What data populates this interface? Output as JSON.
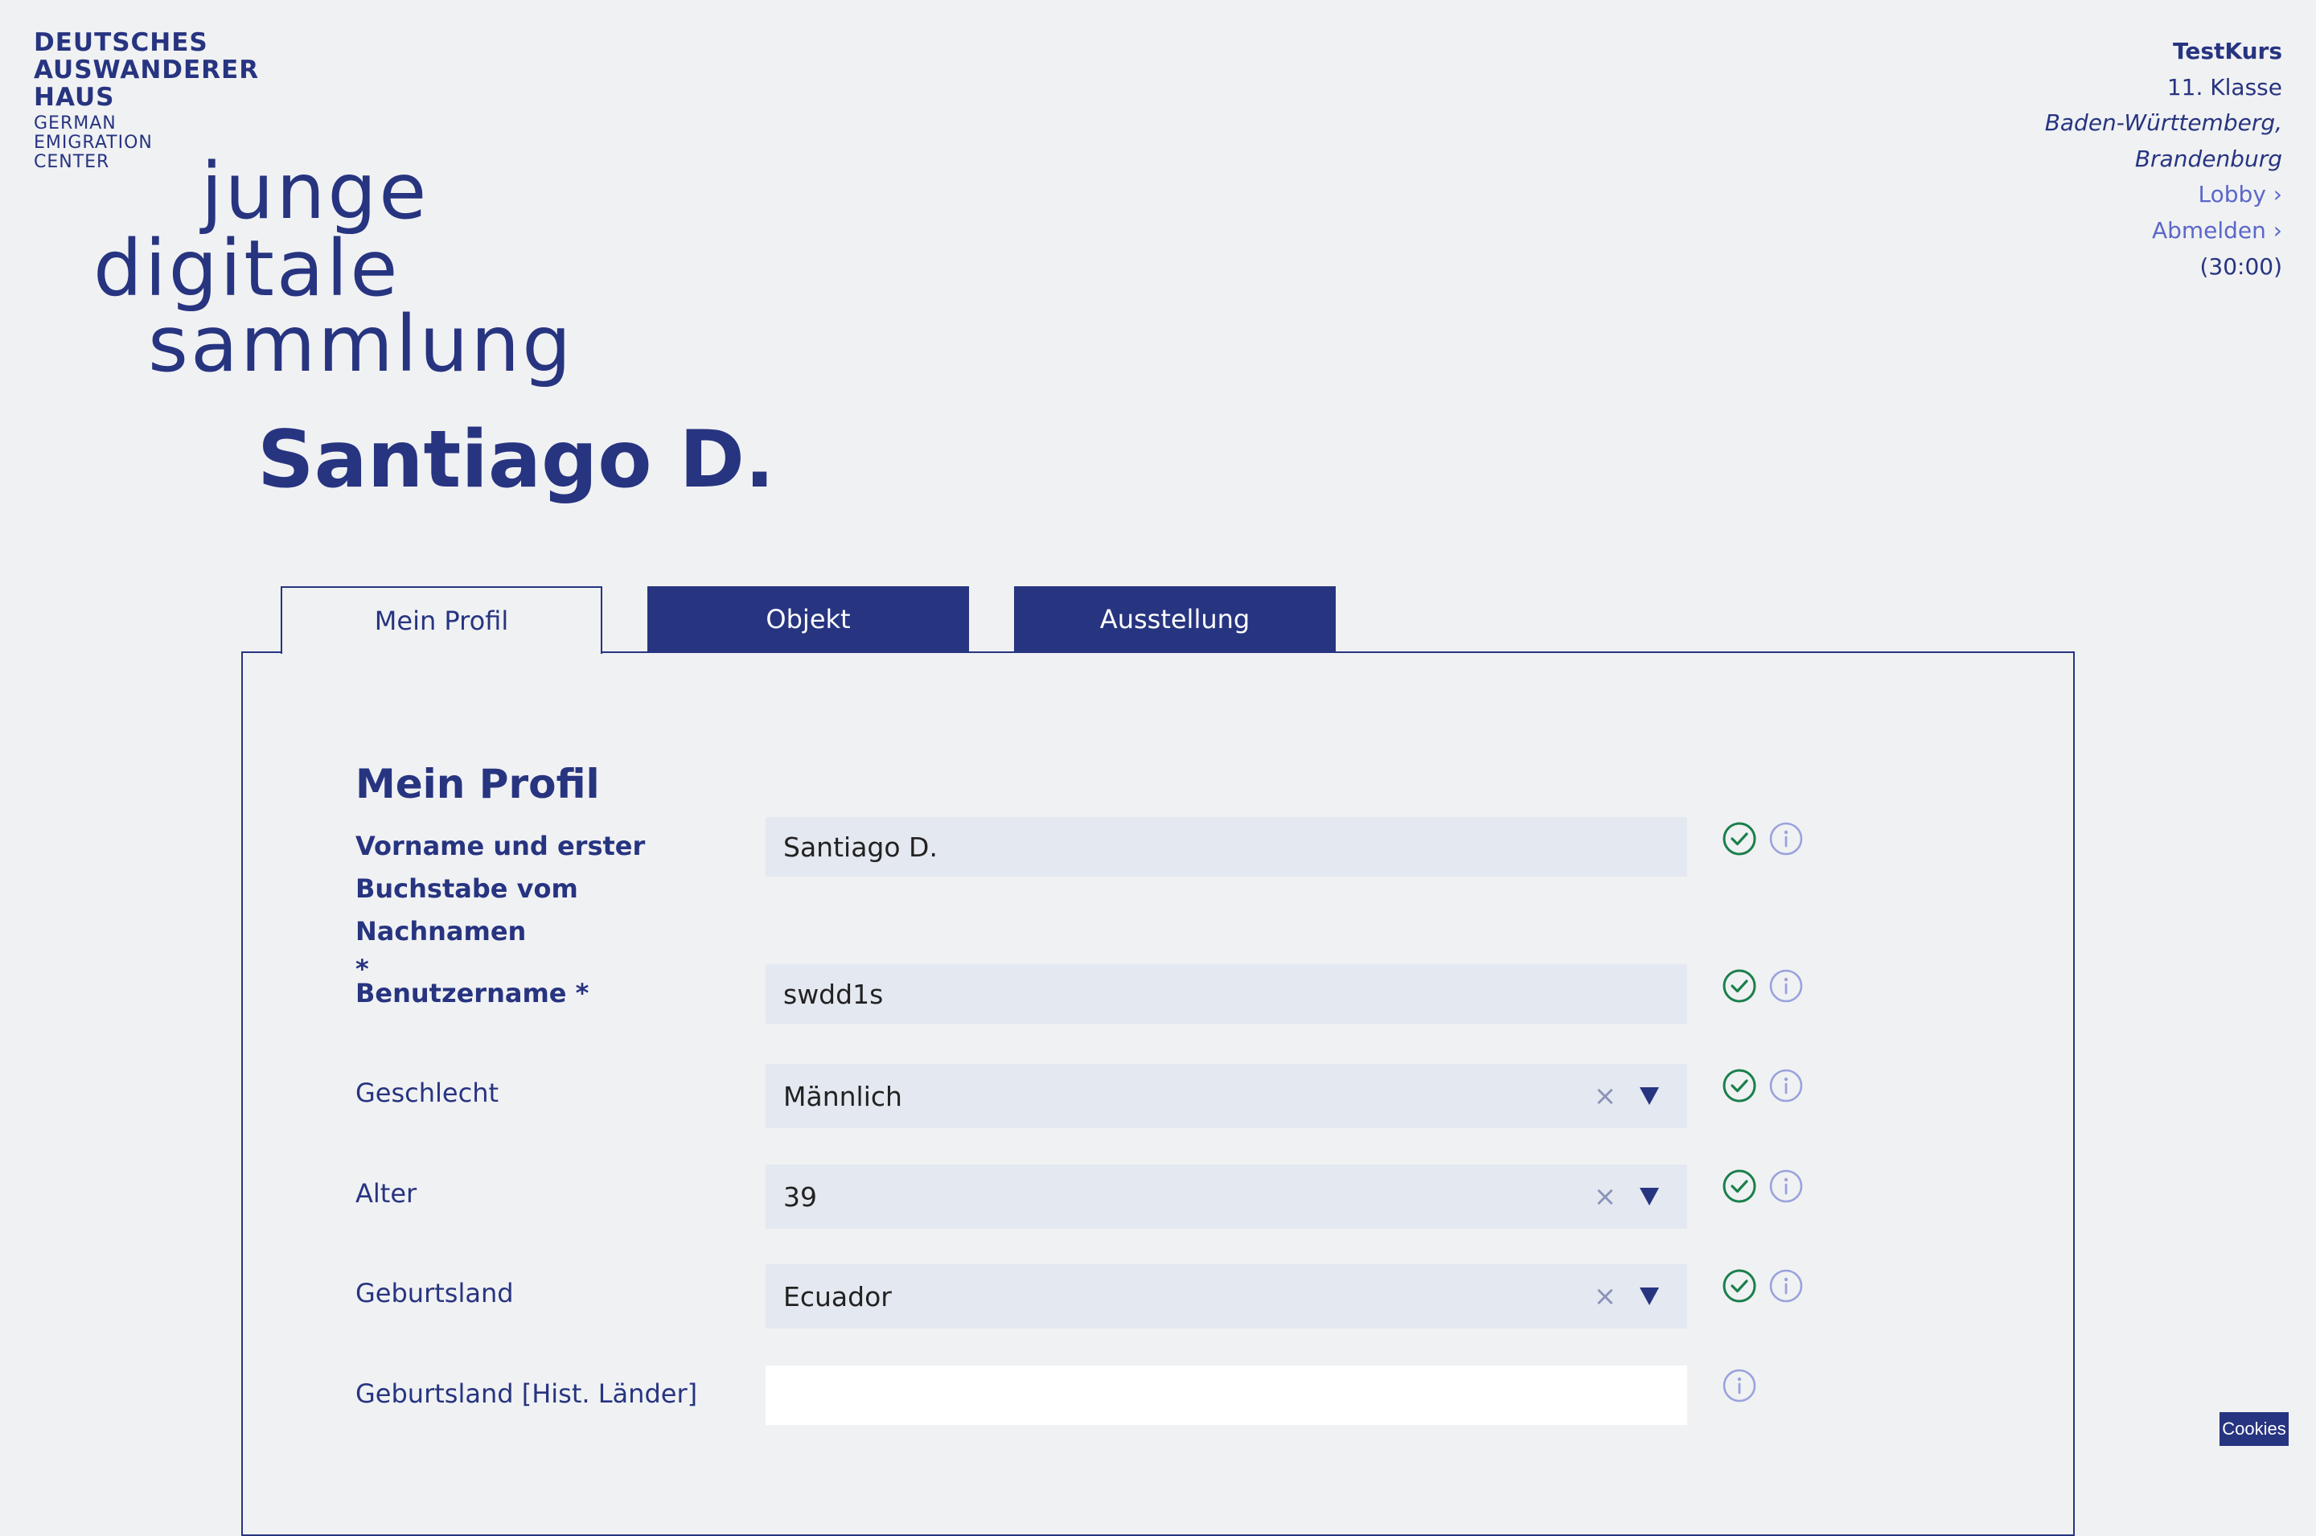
{
  "brand": {
    "dah_lines": [
      "DEUTSCHES",
      "AUSWANDERER",
      "HAUS"
    ],
    "dah_sub_lines": [
      "GERMAN",
      "EMIGRATION",
      "CENTER"
    ],
    "jds_lines": [
      "junge",
      "digitale",
      "sammlung"
    ]
  },
  "page_title": "Santiago D.",
  "user": {
    "course": "TestKurs",
    "grade": "11. Klasse",
    "state_1": "Baden-Württemberg,",
    "state_2": "Brandenburg",
    "lobby_link": "Lobby ›",
    "logout_link": "Abmelden ›",
    "timer": "(30:00)"
  },
  "tabs": [
    {
      "label": "Mein Profil",
      "active": true
    },
    {
      "label": "Objekt",
      "active": false
    },
    {
      "label": "Ausstellung",
      "active": false
    }
  ],
  "form": {
    "section_title": "Mein Profil",
    "fields": [
      {
        "label_lines": [
          "Vorname und erster",
          "Buchstabe vom Nachnamen",
          "*"
        ],
        "value": "Santiago D.",
        "type": "text",
        "valid": true
      },
      {
        "label": "Benutzername *",
        "value": "swdd1s",
        "type": "text",
        "valid": true
      },
      {
        "label": "Geschlecht",
        "value": "Männlich",
        "type": "select",
        "valid": true
      },
      {
        "label": "Alter",
        "value": "39",
        "type": "select",
        "valid": true
      },
      {
        "label": "Geburtsland",
        "value": "Ecuador",
        "type": "select",
        "valid": true
      },
      {
        "label": "Geburtsland [Hist. Länder]",
        "value": "",
        "type": "text",
        "valid": false
      }
    ],
    "clear_symbol": "×"
  },
  "icons": {
    "valid": "check-circle-icon",
    "info": "info-circle-icon",
    "dropdown": "triangle-down-icon"
  },
  "colors": {
    "brand_blue": "#273480",
    "link_blue": "#5b67c8",
    "valid_green": "#1a7f4b",
    "info_lavender": "#9aa2dc",
    "field_bg": "#e4e8f0",
    "page_bg": "#f0f1f3"
  },
  "cookies_label": "Cookies"
}
